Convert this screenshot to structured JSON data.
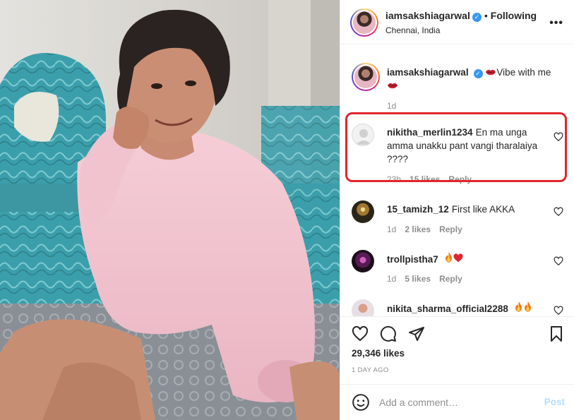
{
  "header": {
    "username": "iamsakshiagarwal",
    "separator": "•",
    "follow_label": "Following",
    "location": "Chennai, India",
    "more_icon": "more-options-icon"
  },
  "caption": {
    "username": "iamsakshiagarwal",
    "text": "Vibe with me",
    "emoji": "lips",
    "time": "1d"
  },
  "comments": [
    {
      "username": "nikitha_merlin1234",
      "text": "En ma unga amma unakku pant vangi tharalaiya ????",
      "time": "23h",
      "likes": "15 likes",
      "reply": "Reply",
      "highlighted": true
    },
    {
      "username": "15_tamizh_12",
      "text": "First like AKKA",
      "time": "1d",
      "likes": "2 likes",
      "reply": "Reply"
    },
    {
      "username": "trollpistha7",
      "text": "",
      "emoji": "fire heart",
      "time": "1d",
      "likes": "5 likes",
      "reply": "Reply"
    },
    {
      "username": "nikita_sharma_official2288",
      "text": "",
      "emoji": "fire fire"
    }
  ],
  "actions": {
    "likes": "29,346 likes",
    "time": "1 DAY AGO"
  },
  "add_comment": {
    "placeholder": "Add a comment…",
    "post_label": "Post"
  },
  "colors": {
    "highlight": "#e0262b",
    "verified": "#3897f0",
    "post_button": "#b2dffc",
    "meta_text": "#8e8e8e"
  }
}
